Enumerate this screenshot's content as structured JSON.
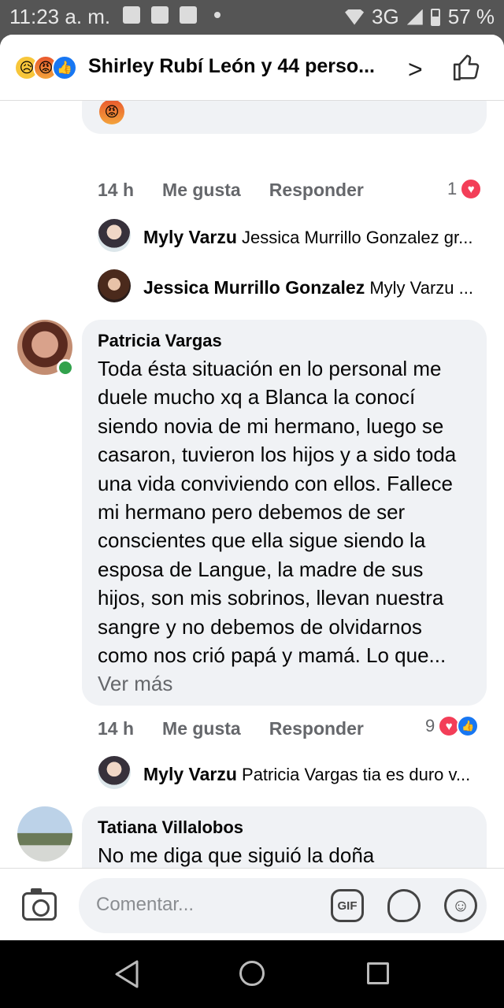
{
  "status_bar": {
    "time": "11:23 a. m.",
    "network": "3G",
    "battery": "57 %"
  },
  "header": {
    "title": "Shirley Rubí León y 44 perso...",
    "reaction_icons": [
      "sad-reaction",
      "angry-reaction",
      "like-reaction"
    ]
  },
  "thread": {
    "top_comment": {
      "time": "14 h",
      "like_label": "Me gusta",
      "reply_label": "Responder",
      "reaction_count": "1"
    },
    "replies_top": [
      {
        "author": "Myly Varzu",
        "text": "Jessica Murrillo Gonzalez gr..."
      },
      {
        "author": "Jessica Murrillo Gonzalez",
        "text": "Myly Varzu ..."
      }
    ],
    "comment_patricia": {
      "author": "Patricia Vargas",
      "text": "Toda ésta situación en lo personal me duele mucho xq a Blanca la conocí siendo novia de mi hermano, luego se casaron, tuvieron los hijos y a sido toda una vida conviviendo con ellos. Fallece mi hermano pero debemos de ser conscientes que ella sigue siendo la esposa de Langue, la madre de sus hijos, son mis sobrinos, llevan nuestra sangre y no debemos de olvidarnos como nos crió papá y mamá. Lo que...",
      "see_more": "Ver más",
      "time": "14 h",
      "like_label": "Me gusta",
      "reply_label": "Responder",
      "reaction_count": "9"
    },
    "reply_patricia": {
      "author": "Myly Varzu",
      "text": "Patricia Vargas tia es duro v..."
    },
    "comment_tatiana": {
      "author": "Tatiana Villalobos",
      "text": "No me diga que siguió la doña molestando a tu madre ,Dios cuida"
    }
  },
  "composer": {
    "placeholder": "Comentar...",
    "gif_label": "GIF"
  }
}
